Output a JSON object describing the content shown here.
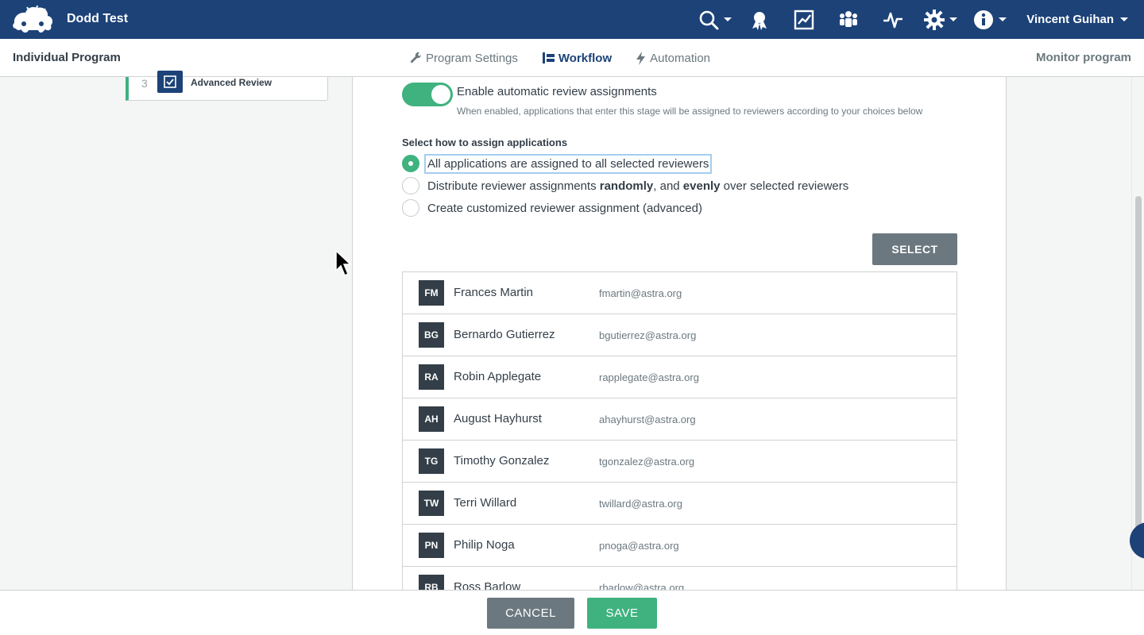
{
  "header": {
    "brand": "Dodd Test",
    "user_name": "Vincent Guihan",
    "icons": [
      "search-icon",
      "award-icon",
      "chart-icon",
      "users-icon",
      "activity-icon",
      "gear-icon",
      "info-icon"
    ]
  },
  "subheader": {
    "program_name": "Individual Program",
    "tabs": [
      {
        "label": "Program Settings",
        "icon": "wrench-icon",
        "active": false
      },
      {
        "label": "Workflow",
        "icon": "workflow-icon",
        "active": true
      },
      {
        "label": "Automation",
        "icon": "bolt-icon",
        "active": false
      }
    ],
    "monitor_label": "Monitor program"
  },
  "stage": {
    "number": "3",
    "label": "Advanced Review"
  },
  "auto_assign": {
    "toggle_on": true,
    "title": "Enable automatic review assignments",
    "description": "When enabled, applications that enter this stage will be assigned to reviewers according to your choices below"
  },
  "assign_method": {
    "label": "Select how to assign applications",
    "option_all": "All applications are assigned to all selected reviewers",
    "option_random_prefix": "Distribute reviewer assignments ",
    "option_random_bold1": "randomly",
    "option_random_mid": ", and ",
    "option_random_bold2": "evenly",
    "option_random_suffix": " over selected reviewers",
    "option_custom": "Create customized reviewer assignment (advanced)",
    "selected": "all"
  },
  "select_label": "SELECT",
  "reviewers": [
    {
      "initials": "FM",
      "name": "Frances Martin",
      "email": "fmartin@astra.org"
    },
    {
      "initials": "BG",
      "name": "Bernardo Gutierrez",
      "email": "bgutierrez@astra.org"
    },
    {
      "initials": "RA",
      "name": "Robin Applegate",
      "email": "rapplegate@astra.org"
    },
    {
      "initials": "AH",
      "name": "August Hayhurst",
      "email": "ahayhurst@astra.org"
    },
    {
      "initials": "TG",
      "name": "Timothy Gonzalez",
      "email": "tgonzalez@astra.org"
    },
    {
      "initials": "TW",
      "name": "Terri Willard",
      "email": "twillard@astra.org"
    },
    {
      "initials": "PN",
      "name": "Philip Noga",
      "email": "pnoga@astra.org"
    },
    {
      "initials": "RB",
      "name": "Ross Barlow",
      "email": "rbarlow@astra.org"
    }
  ],
  "footer": {
    "cancel_label": "CANCEL",
    "save_label": "SAVE"
  },
  "colors": {
    "nav": "#1c4278",
    "accent_green": "#3fb27f",
    "button_gray": "#6b787f",
    "avatar": "#333e48"
  }
}
